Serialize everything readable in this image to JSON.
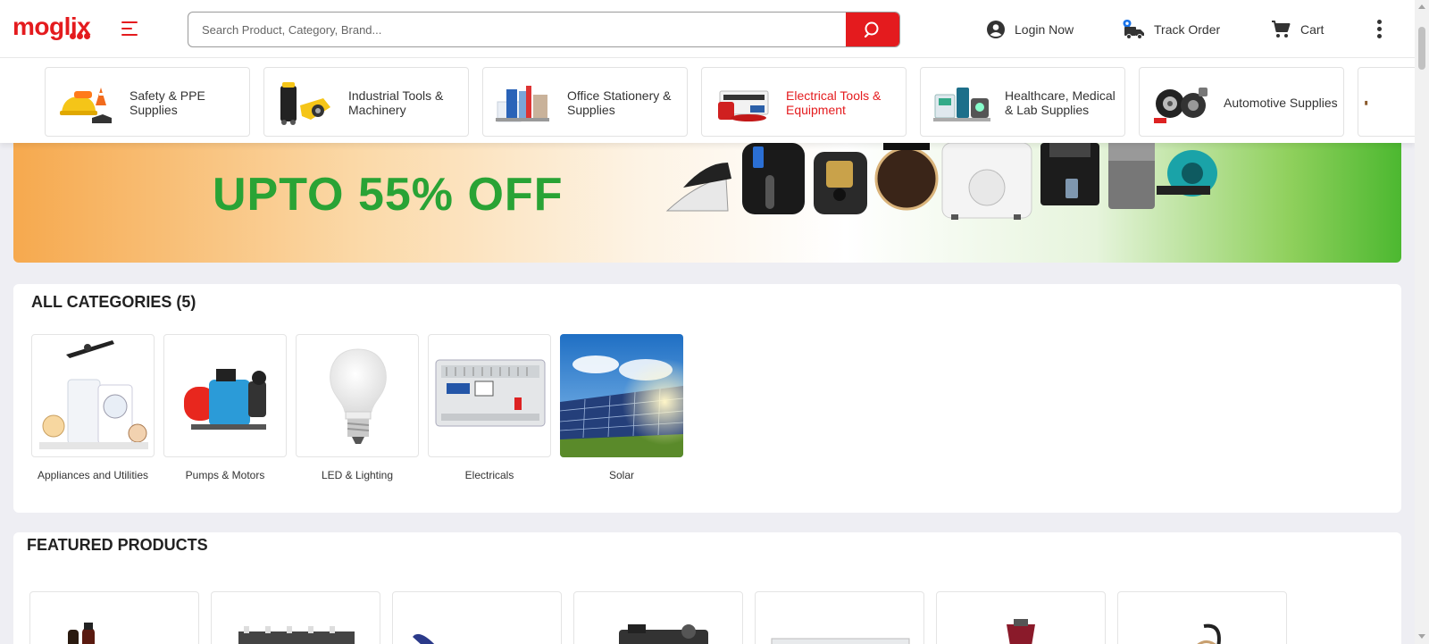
{
  "brand": {
    "logo_text": "moglix",
    "accent": "#e41b1e"
  },
  "header": {
    "search_placeholder": "Search Product, Category, Brand...",
    "login_label": "Login Now",
    "track_label": "Track Order",
    "cart_label": "Cart",
    "icons": [
      "menu-icon",
      "search-icon",
      "user-icon",
      "truck-icon",
      "cart-icon",
      "kebab-icon"
    ]
  },
  "category_strip": [
    {
      "label": "Safety & PPE Supplies",
      "active": false
    },
    {
      "label": "Industrial Tools & Machinery",
      "active": false
    },
    {
      "label": "Office Stationery & Supplies",
      "active": false
    },
    {
      "label": "Electrical Tools & Equipment",
      "active": true
    },
    {
      "label": "Healthcare, Medical & Lab Supplies",
      "active": false
    },
    {
      "label": "Automotive Supplies",
      "active": false
    }
  ],
  "banner": {
    "headline": "UPTO 55% OFF",
    "text_color": "#29a335"
  },
  "all_categories": {
    "title": "ALL CATEGORIES (5)",
    "items": [
      {
        "label": "Appliances and Utilities"
      },
      {
        "label": "Pumps & Motors"
      },
      {
        "label": "LED & Lighting"
      },
      {
        "label": "Electricals"
      },
      {
        "label": "Solar"
      }
    ]
  },
  "featured": {
    "title": "FEATURED PRODUCTS",
    "visible_cards": 7
  }
}
